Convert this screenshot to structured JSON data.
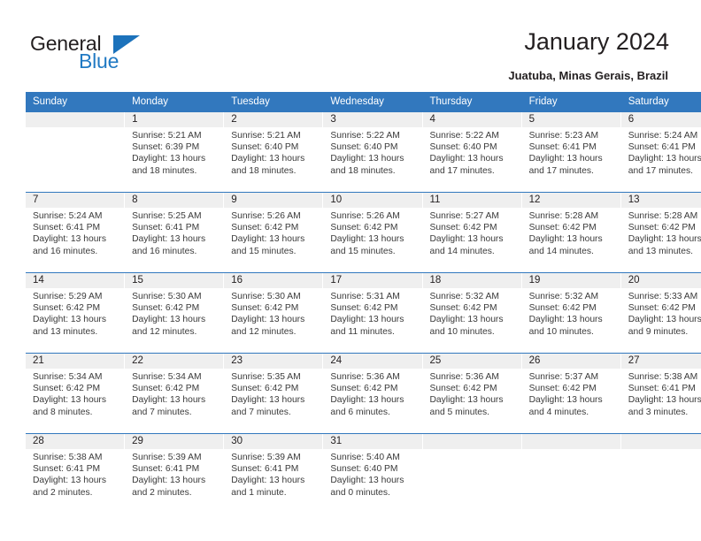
{
  "brand": {
    "name_part1": "General",
    "name_part2": "Blue",
    "triangle_icon": "triangle-icon",
    "color_primary": "#1c72bb",
    "color_text": "#231f20"
  },
  "header": {
    "title": "January 2024",
    "subtitle": "Juatuba, Minas Gerais, Brazil"
  },
  "calendar": {
    "header_bg": "#3278be",
    "daynum_bg": "#efefef",
    "weekday_headers": [
      "Sunday",
      "Monday",
      "Tuesday",
      "Wednesday",
      "Thursday",
      "Friday",
      "Saturday"
    ],
    "weeks": [
      [
        {
          "day": "",
          "sunrise": "",
          "sunset": "",
          "daylight1": "",
          "daylight2": ""
        },
        {
          "day": "1",
          "sunrise": "Sunrise: 5:21 AM",
          "sunset": "Sunset: 6:39 PM",
          "daylight1": "Daylight: 13 hours",
          "daylight2": "and 18 minutes."
        },
        {
          "day": "2",
          "sunrise": "Sunrise: 5:21 AM",
          "sunset": "Sunset: 6:40 PM",
          "daylight1": "Daylight: 13 hours",
          "daylight2": "and 18 minutes."
        },
        {
          "day": "3",
          "sunrise": "Sunrise: 5:22 AM",
          "sunset": "Sunset: 6:40 PM",
          "daylight1": "Daylight: 13 hours",
          "daylight2": "and 18 minutes."
        },
        {
          "day": "4",
          "sunrise": "Sunrise: 5:22 AM",
          "sunset": "Sunset: 6:40 PM",
          "daylight1": "Daylight: 13 hours",
          "daylight2": "and 17 minutes."
        },
        {
          "day": "5",
          "sunrise": "Sunrise: 5:23 AM",
          "sunset": "Sunset: 6:41 PM",
          "daylight1": "Daylight: 13 hours",
          "daylight2": "and 17 minutes."
        },
        {
          "day": "6",
          "sunrise": "Sunrise: 5:24 AM",
          "sunset": "Sunset: 6:41 PM",
          "daylight1": "Daylight: 13 hours",
          "daylight2": "and 17 minutes."
        }
      ],
      [
        {
          "day": "7",
          "sunrise": "Sunrise: 5:24 AM",
          "sunset": "Sunset: 6:41 PM",
          "daylight1": "Daylight: 13 hours",
          "daylight2": "and 16 minutes."
        },
        {
          "day": "8",
          "sunrise": "Sunrise: 5:25 AM",
          "sunset": "Sunset: 6:41 PM",
          "daylight1": "Daylight: 13 hours",
          "daylight2": "and 16 minutes."
        },
        {
          "day": "9",
          "sunrise": "Sunrise: 5:26 AM",
          "sunset": "Sunset: 6:42 PM",
          "daylight1": "Daylight: 13 hours",
          "daylight2": "and 15 minutes."
        },
        {
          "day": "10",
          "sunrise": "Sunrise: 5:26 AM",
          "sunset": "Sunset: 6:42 PM",
          "daylight1": "Daylight: 13 hours",
          "daylight2": "and 15 minutes."
        },
        {
          "day": "11",
          "sunrise": "Sunrise: 5:27 AM",
          "sunset": "Sunset: 6:42 PM",
          "daylight1": "Daylight: 13 hours",
          "daylight2": "and 14 minutes."
        },
        {
          "day": "12",
          "sunrise": "Sunrise: 5:28 AM",
          "sunset": "Sunset: 6:42 PM",
          "daylight1": "Daylight: 13 hours",
          "daylight2": "and 14 minutes."
        },
        {
          "day": "13",
          "sunrise": "Sunrise: 5:28 AM",
          "sunset": "Sunset: 6:42 PM",
          "daylight1": "Daylight: 13 hours",
          "daylight2": "and 13 minutes."
        }
      ],
      [
        {
          "day": "14",
          "sunrise": "Sunrise: 5:29 AM",
          "sunset": "Sunset: 6:42 PM",
          "daylight1": "Daylight: 13 hours",
          "daylight2": "and 13 minutes."
        },
        {
          "day": "15",
          "sunrise": "Sunrise: 5:30 AM",
          "sunset": "Sunset: 6:42 PM",
          "daylight1": "Daylight: 13 hours",
          "daylight2": "and 12 minutes."
        },
        {
          "day": "16",
          "sunrise": "Sunrise: 5:30 AM",
          "sunset": "Sunset: 6:42 PM",
          "daylight1": "Daylight: 13 hours",
          "daylight2": "and 12 minutes."
        },
        {
          "day": "17",
          "sunrise": "Sunrise: 5:31 AM",
          "sunset": "Sunset: 6:42 PM",
          "daylight1": "Daylight: 13 hours",
          "daylight2": "and 11 minutes."
        },
        {
          "day": "18",
          "sunrise": "Sunrise: 5:32 AM",
          "sunset": "Sunset: 6:42 PM",
          "daylight1": "Daylight: 13 hours",
          "daylight2": "and 10 minutes."
        },
        {
          "day": "19",
          "sunrise": "Sunrise: 5:32 AM",
          "sunset": "Sunset: 6:42 PM",
          "daylight1": "Daylight: 13 hours",
          "daylight2": "and 10 minutes."
        },
        {
          "day": "20",
          "sunrise": "Sunrise: 5:33 AM",
          "sunset": "Sunset: 6:42 PM",
          "daylight1": "Daylight: 13 hours",
          "daylight2": "and 9 minutes."
        }
      ],
      [
        {
          "day": "21",
          "sunrise": "Sunrise: 5:34 AM",
          "sunset": "Sunset: 6:42 PM",
          "daylight1": "Daylight: 13 hours",
          "daylight2": "and 8 minutes."
        },
        {
          "day": "22",
          "sunrise": "Sunrise: 5:34 AM",
          "sunset": "Sunset: 6:42 PM",
          "daylight1": "Daylight: 13 hours",
          "daylight2": "and 7 minutes."
        },
        {
          "day": "23",
          "sunrise": "Sunrise: 5:35 AM",
          "sunset": "Sunset: 6:42 PM",
          "daylight1": "Daylight: 13 hours",
          "daylight2": "and 7 minutes."
        },
        {
          "day": "24",
          "sunrise": "Sunrise: 5:36 AM",
          "sunset": "Sunset: 6:42 PM",
          "daylight1": "Daylight: 13 hours",
          "daylight2": "and 6 minutes."
        },
        {
          "day": "25",
          "sunrise": "Sunrise: 5:36 AM",
          "sunset": "Sunset: 6:42 PM",
          "daylight1": "Daylight: 13 hours",
          "daylight2": "and 5 minutes."
        },
        {
          "day": "26",
          "sunrise": "Sunrise: 5:37 AM",
          "sunset": "Sunset: 6:42 PM",
          "daylight1": "Daylight: 13 hours",
          "daylight2": "and 4 minutes."
        },
        {
          "day": "27",
          "sunrise": "Sunrise: 5:38 AM",
          "sunset": "Sunset: 6:41 PM",
          "daylight1": "Daylight: 13 hours",
          "daylight2": "and 3 minutes."
        }
      ],
      [
        {
          "day": "28",
          "sunrise": "Sunrise: 5:38 AM",
          "sunset": "Sunset: 6:41 PM",
          "daylight1": "Daylight: 13 hours",
          "daylight2": "and 2 minutes."
        },
        {
          "day": "29",
          "sunrise": "Sunrise: 5:39 AM",
          "sunset": "Sunset: 6:41 PM",
          "daylight1": "Daylight: 13 hours",
          "daylight2": "and 2 minutes."
        },
        {
          "day": "30",
          "sunrise": "Sunrise: 5:39 AM",
          "sunset": "Sunset: 6:41 PM",
          "daylight1": "Daylight: 13 hours",
          "daylight2": "and 1 minute."
        },
        {
          "day": "31",
          "sunrise": "Sunrise: 5:40 AM",
          "sunset": "Sunset: 6:40 PM",
          "daylight1": "Daylight: 13 hours",
          "daylight2": "and 0 minutes."
        },
        {
          "day": "",
          "sunrise": "",
          "sunset": "",
          "daylight1": "",
          "daylight2": ""
        },
        {
          "day": "",
          "sunrise": "",
          "sunset": "",
          "daylight1": "",
          "daylight2": ""
        },
        {
          "day": "",
          "sunrise": "",
          "sunset": "",
          "daylight1": "",
          "daylight2": ""
        }
      ]
    ]
  }
}
